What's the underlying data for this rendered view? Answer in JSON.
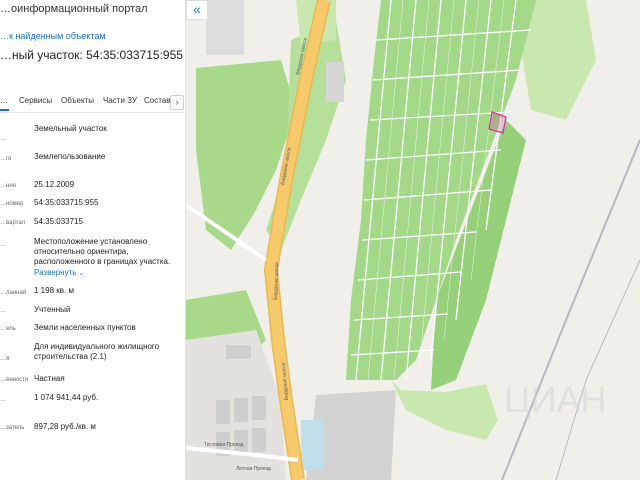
{
  "header": {
    "portal_title": "…оинформационный портал",
    "back_link": "…к найденным объектам",
    "parcel_title": "…ный участок: 54:35:033715:955"
  },
  "tabs": {
    "items": [
      "…",
      "Сервисы",
      "Объекты",
      "Части ЗУ",
      "Состав"
    ],
    "next_icon": "chevron-right-icon"
  },
  "fields": [
    {
      "label": "…",
      "value": "Земельный участок"
    },
    {
      "label": "…го",
      "value": "Землепользование"
    },
    {
      "label": "…ния",
      "value": "25.12.2009"
    },
    {
      "label": "…номер",
      "value": "54:35:033715:955"
    },
    {
      "label": "…вартал",
      "value": "54:35:033715"
    },
    {
      "label": "…",
      "value": "Местоположение установлено относительно ориентира, расположенного в границах участка."
    },
    {
      "label": "…ланная",
      "value": "1 198 кв. м"
    },
    {
      "label": "…",
      "value": "Учтенный"
    },
    {
      "label": "…ель",
      "value": "Земли населенных пунктов"
    },
    {
      "label": "…я",
      "value": "Для индивидуального жилищного строительства (2.1)"
    },
    {
      "label": "…енности",
      "value": "Частная"
    },
    {
      "label": "…",
      "value": "1 074 941,44 руб."
    },
    {
      "label": "…затель",
      "value": "897,28 руб./кв. м"
    }
  ],
  "expand_link": "Развернуть",
  "map": {
    "collapse_icon": "double-chevron-left-icon",
    "street_main": "Бердское шоссе",
    "street_lower_1": "Тестовая Проезд",
    "street_lower_2": "Летная Проезд",
    "watermark": "ЦИАН",
    "colors": {
      "background": "#f1efea",
      "green": "#a8d98a",
      "road": "#f6c96a",
      "highlight": "#d1329c"
    }
  }
}
